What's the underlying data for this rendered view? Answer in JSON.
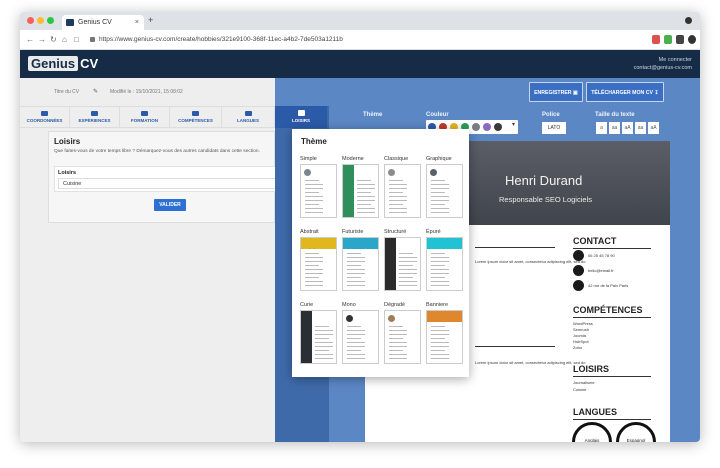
{
  "browser": {
    "tab_title": "Genius CV",
    "tab_close": "×",
    "new_tab": "+",
    "url": "https://www.genius-cv.com/create/hobbies/321e9100-368f-11ec-a4b2-7de503a1211b"
  },
  "site": {
    "logo_highlight": "Genius",
    "logo_rest": "CV",
    "account_name": "Me connecter",
    "account_email": "contact@genius-cv.com"
  },
  "editor": {
    "draft_name": "Titre du CV",
    "modified": "Modifié le : 15/10/2021, 15:08:02",
    "tabs": [
      {
        "label": "COORDONNÉES"
      },
      {
        "label": "EXPÉRIENCES"
      },
      {
        "label": "FORMATION"
      },
      {
        "label": "COMPÉTENCES"
      },
      {
        "label": "LANGUES"
      },
      {
        "label": "LOISIRS"
      }
    ],
    "section_title": "Loisirs",
    "section_hint": "Que faites-vous de votre temps libre ? Démarquez-vous des autres candidats dans cette section.",
    "field_label": "Loisirs",
    "field_value": "Cuisine",
    "validate_label": "VALIDER"
  },
  "actions": {
    "save_label": "ENREGISTRER",
    "download_label": "TÉLÉCHARGER MON CV"
  },
  "toolbar": {
    "theme_label": "Thème",
    "color_label": "Couleur",
    "font_label": "Police",
    "size_label": "Taille du texte",
    "font_value": "LATO",
    "sizes": [
      "a",
      "aa",
      "aA",
      "aa",
      "aA"
    ],
    "colors": [
      "#2b5aa8",
      "#c0392b",
      "#e6b422",
      "#2d9c5a",
      "#7a7f86",
      "#8a6bbf",
      "#3a3a3a"
    ]
  },
  "cv_preview": {
    "name": "Henri Durand",
    "role": "Responsable SEO Logiciels",
    "contact_title": "CONTACT",
    "contact_lines": [
      "06 25 45 78 90",
      "hello@email.fr",
      "42 rue de la Paix Paris"
    ],
    "skills_title": "COMPÉTENCES",
    "skills": [
      "WordPress",
      "Semrush",
      "Joomla",
      "HubSpot",
      "Zoho"
    ],
    "hobbies_title": "LOISIRS",
    "hobbies": [
      "Journalisme",
      "Cuisine"
    ],
    "languages_title": "LANGUES",
    "languages": [
      "Anglais",
      "Espagnol"
    ],
    "lorem": "Lorem ipsum dolor sit amet, consectetur adipiscing elit, sed do"
  },
  "theme_modal": {
    "title": "Thème",
    "themes": [
      {
        "name": "Simple",
        "accent": "#7d8590"
      },
      {
        "name": "Moderne",
        "accent": "#2f8f5b"
      },
      {
        "name": "Classique",
        "accent": "#8c8c8c"
      },
      {
        "name": "Graphique",
        "accent": "#5a6068"
      },
      {
        "name": "Abstrait",
        "accent": "#e0b81e"
      },
      {
        "name": "Futuriste",
        "accent": "#2aa6c9"
      },
      {
        "name": "Structuré",
        "accent": "#2b2b2b"
      },
      {
        "name": "Épuré",
        "accent": "#20c2d4"
      },
      {
        "name": "Curie",
        "accent": "#2a2f36"
      },
      {
        "name": "Mono",
        "accent": "#333333"
      },
      {
        "name": "Dégradé",
        "accent": "#a17c5d"
      },
      {
        "name": "Banniere",
        "accent": "#e0862d"
      }
    ]
  }
}
